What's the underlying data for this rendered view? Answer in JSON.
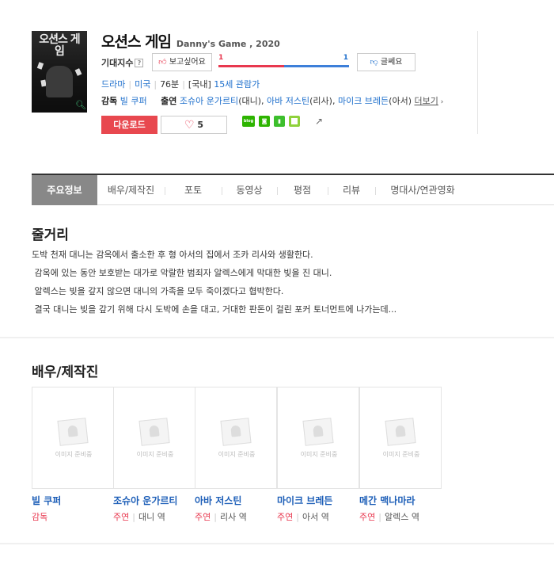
{
  "movie": {
    "title_ko": "오션스 게임",
    "title_en": "Danny's Game , 2020",
    "poster_title": "오션스 게임",
    "genre": "드라마",
    "country": "미국",
    "runtime": "76분",
    "rating_prefix": "[국내]",
    "rating": "15세 관람가",
    "director_label": "감독",
    "director": "빌 쿠퍼",
    "cast_label": "출연",
    "cast_1": "조슈아 운가르티",
    "cast_1_role": "(대니),",
    "cast_2": "아바 저스틴",
    "cast_2_role": "(리사),",
    "cast_3": "마이크 브레든",
    "cast_3_role": "(아서)",
    "more_label": "더보기"
  },
  "expectation": {
    "label": "기대지수",
    "help": "?",
    "want_label": "보고싶어요",
    "want_count": "1",
    "meh_count": "1",
    "meh_label": "글쎄요",
    "want_ratio": 0.5
  },
  "actions": {
    "download_label": "다운로드",
    "like_count": "5",
    "share_icons": [
      "blog-icon",
      "chat-icon",
      "bookmark-icon",
      "square-icon",
      "share-icon"
    ],
    "share_blog_text": "blog"
  },
  "tabs": [
    {
      "label": "주요정보",
      "active": true
    },
    {
      "label": "배우/제작진",
      "active": false
    },
    {
      "label": "포토",
      "active": false
    },
    {
      "label": "동영상",
      "active": false
    },
    {
      "label": "평점",
      "active": false
    },
    {
      "label": "리뷰",
      "active": false
    },
    {
      "label": "명대사/연관영화",
      "active": false
    }
  ],
  "synopsis": {
    "heading": "줄거리",
    "lines": [
      "도박 천재 대니는 감옥에서 출소한 후 형 아서의 집에서 조카 리사와 생활한다.",
      " 감옥에 있는 동안 보호받는 대가로 악랄한 범죄자 알렉스에게 막대한 빚을 진 대니.",
      " 알렉스는 빚을 갚지 않으면 대니의 가족을 모두 죽이겠다고 협박한다.",
      " 결국 대니는 빚을 갚기 위해 다시 도박에 손을 대고, 거대한 판돈이 걸린 포커 토너먼트에 나가는데..."
    ]
  },
  "cast_section": {
    "heading": "배우/제작진",
    "placeholder_text": "이미지 준비중",
    "people": [
      {
        "name": "빌 쿠퍼",
        "kind": "감독",
        "role": ""
      },
      {
        "name": "조슈아 운가르티",
        "kind": "주연",
        "role": "대니 역"
      },
      {
        "name": "아바 저스틴",
        "kind": "주연",
        "role": "리사 역"
      },
      {
        "name": "마이크 브레든",
        "kind": "주연",
        "role": "아서 역"
      },
      {
        "name": "메간 맥나마라",
        "kind": "주연",
        "role": "알렉스 역"
      }
    ]
  },
  "colors": {
    "accent_red": "#e8384f",
    "accent_blue": "#1e6fcc",
    "download_bg": "#e8484f",
    "share_green": "#2db400"
  }
}
